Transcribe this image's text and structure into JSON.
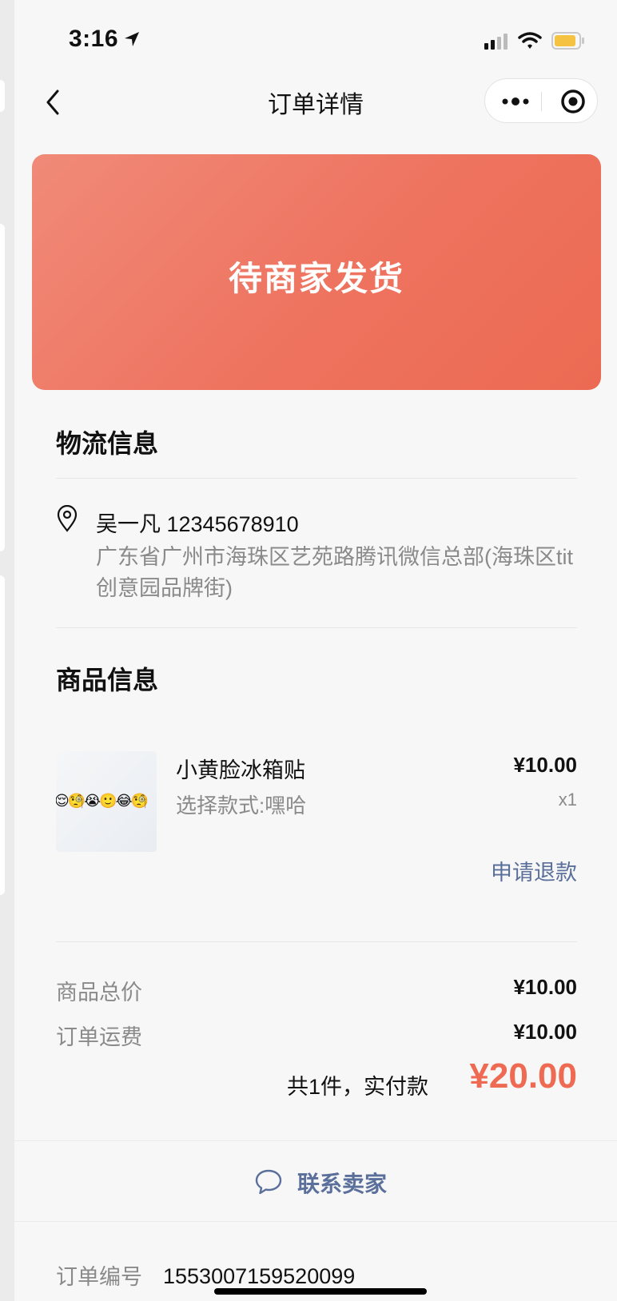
{
  "status_bar": {
    "time": "3:16"
  },
  "nav": {
    "title": "订单详情"
  },
  "banner": {
    "status_text": "待商家发货"
  },
  "logistics": {
    "title": "物流信息",
    "receiver": "吴一凡 12345678910",
    "address": "广东省广州市海珠区艺苑路腾讯微信总部(海珠区tit创意园品牌街)"
  },
  "goods": {
    "title": "商品信息",
    "items": [
      {
        "name": "小黄脸冰箱贴",
        "spec": "选择款式:嘿哈",
        "price": "¥10.00",
        "qty": "x1",
        "thumb_text": "😌🧐😭🙂😂🧐",
        "refund_label": "申请退款"
      }
    ]
  },
  "summary": {
    "goods_total_label": "商品总价",
    "goods_total": "¥10.00",
    "shipping_label": "订单运费",
    "shipping": "¥10.00",
    "total_label": "共1件，实付款",
    "total": "¥20.00"
  },
  "contact": {
    "label": "联系卖家"
  },
  "order": {
    "number_label": "订单编号",
    "number": "1553007159520099"
  },
  "colors": {
    "accent": "#ee6a52",
    "link": "#5b6f9b"
  }
}
